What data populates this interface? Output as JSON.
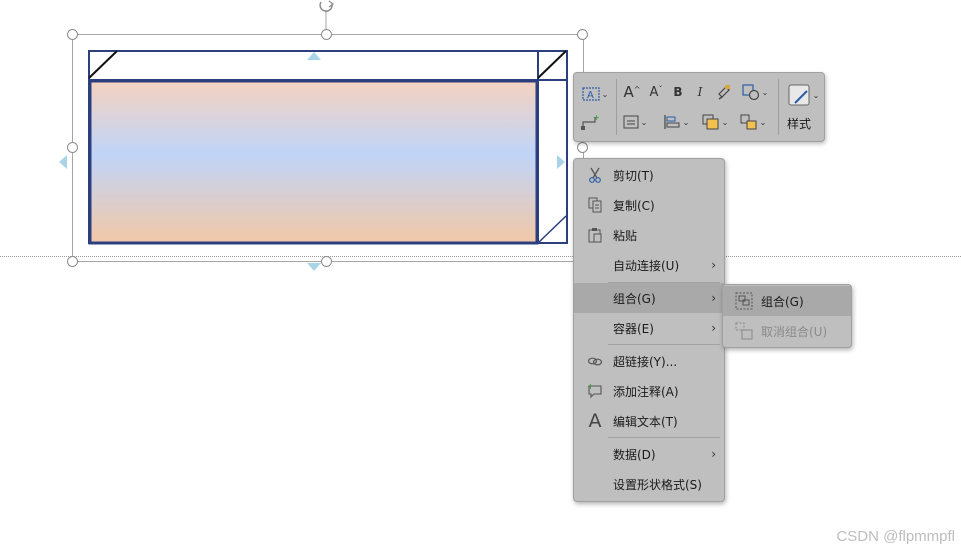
{
  "colors": {
    "menu_bg": "#bfbfbf",
    "menu_highlight": "#a9a9a9",
    "shape_border": "#2b3f7e",
    "gradient_top": "#f4d2c0",
    "gradient_middle": "#c0d4f8",
    "gradient_bottom": "#f2c8a8",
    "disabled_text": "#8a8a8a"
  },
  "toolbar": {
    "textbox_icon": "textbox-icon",
    "increase_font_label": "A",
    "decrease_font_label": "A",
    "bold_label": "B",
    "italic_label": "I",
    "style_label": "样式"
  },
  "context_menu": {
    "items": [
      {
        "label": "剪切(T)",
        "icon": "scissors-icon"
      },
      {
        "label": "复制(C)",
        "icon": "copy-icon"
      },
      {
        "label": "粘贴",
        "icon": "paste-icon"
      },
      {
        "label": "自动连接(U)",
        "icon": "",
        "submenu": true
      },
      {
        "label": "组合(G)",
        "icon": "",
        "submenu": true,
        "highlighted": true
      },
      {
        "label": "容器(E)",
        "icon": "",
        "submenu": true
      },
      {
        "label": "超链接(Y)...",
        "icon": "hyperlink-icon"
      },
      {
        "label": "添加注释(A)",
        "icon": "comment-icon"
      },
      {
        "label": "编辑文本(T)",
        "icon": "edit-text-icon",
        "glyph": "A"
      },
      {
        "label": "数据(D)",
        "icon": "",
        "submenu": true
      },
      {
        "label": "设置形状格式(S)",
        "icon": ""
      }
    ]
  },
  "submenu": {
    "items": [
      {
        "label": "组合(G)",
        "icon": "group-icon",
        "enabled": true
      },
      {
        "label": "取消组合(U)",
        "icon": "ungroup-icon",
        "enabled": false
      }
    ]
  },
  "watermark": "CSDN @flpmmpfl"
}
